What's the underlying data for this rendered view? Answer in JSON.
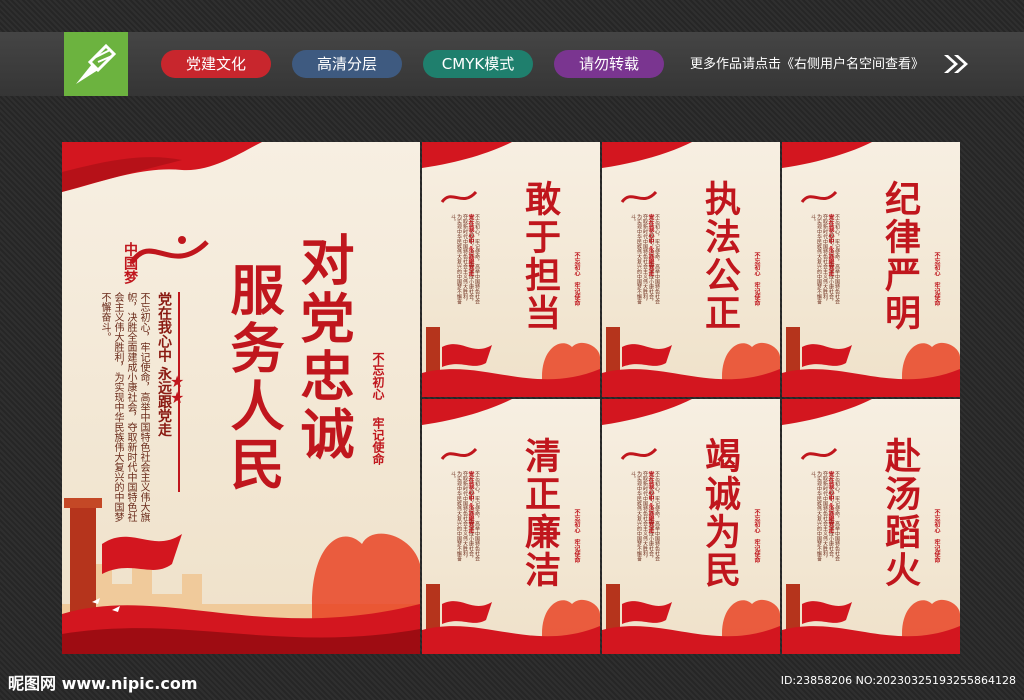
{
  "toolbar": {
    "tags": [
      "党建文化",
      "高清分层",
      "CMYK模式",
      "请勿转载"
    ],
    "promo": "更多作品请点击《右侧用户名空间查看》",
    "colors": {
      "bar": "#3d3d3d",
      "logo": "#6cb33f",
      "tag1": "#c8262d",
      "tag2": "#3e5a80",
      "tag3": "#1f7f6d",
      "tag4": "#7a3590"
    }
  },
  "main_panel": {
    "title_col1": "对党忠诚",
    "title_col2": "服务人民",
    "sub_heading": "党在我心中  永远跟党走",
    "body": "不忘初心，牢记使命，高举中国特色社会主义伟大旗帜，决胜全面建成小康社会，夺取新时代中国特色社会主义伟大胜利，为实现中华民族伟大复兴的中国梦不懈奋斗。",
    "seal_1": "不忘初心",
    "seal_2": "牢记使命",
    "logo_text": "中国梦"
  },
  "small_panels": [
    {
      "title": "敢于担当"
    },
    {
      "title": "执法公正"
    },
    {
      "title": "纪律严明"
    },
    {
      "title": "清正廉洁"
    },
    {
      "title": "竭诚为民"
    },
    {
      "title": "赴汤蹈火"
    }
  ],
  "small_common": {
    "sub_heading": "党在我心中  永远跟党走",
    "body": "不忘初心，牢记使命，高举中国特色社会主义伟大旗帜，决胜全面建成小康社会，夺取新时代中国特色社会主义伟大胜利，为实现中华民族伟大复兴的中国梦不懈奋斗。",
    "seal_1": "不忘初心",
    "seal_2": "牢记使命",
    "logo_text": "中国梦"
  },
  "footer": {
    "site": "昵图网 www.nipic.com",
    "id": "ID:23858206 NO:20230325193255864128"
  }
}
